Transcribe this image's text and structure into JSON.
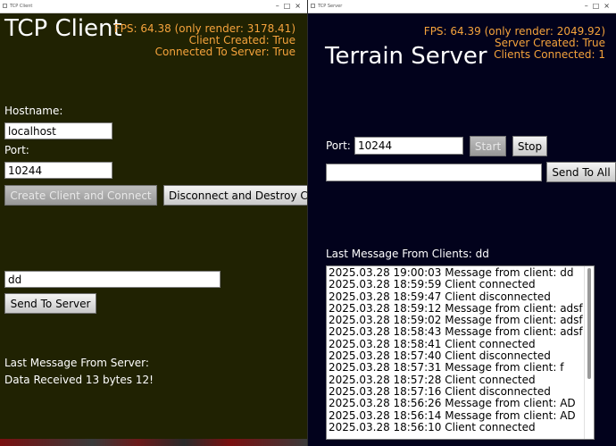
{
  "client": {
    "window_title": "TCP Client",
    "title": "TCP Client",
    "fps_text": "FPS: 64.38 (only render: 3178.41)",
    "status_created": "Client Created: True",
    "status_connected": "Connected To Server: True",
    "hostname_label": "Hostname:",
    "hostname_value": "localhost",
    "port_label": "Port:",
    "port_value": "10244",
    "create_button": "Create Client and Connect",
    "disconnect_button": "Disconnect and Destroy C",
    "message_value": "dd",
    "send_button": "Send To Server",
    "last_message_label": "Last Message From Server:",
    "last_message_value": "Data Received 13 bytes 12!"
  },
  "server": {
    "window_title": "TCP Server",
    "title": "Terrain Server",
    "fps_text": "FPS: 64.39 (only render: 2049.92)",
    "status_created": "Server Created: True",
    "status_clients": "Clients Connected: 1",
    "port_label": "Port:",
    "port_value": "10244",
    "start_button": "Start",
    "stop_button": "Stop",
    "message_value": "",
    "send_all_button": "Send To All",
    "last_message_label": "Last Message From Clients:  dd",
    "log": [
      "2025.03.28 19:00:03 Message from client: dd",
      "2025.03.28 18:59:59 Client connected",
      "2025.03.28 18:59:47 Client disconnected",
      "2025.03.28 18:59:12 Message from client: adsf",
      "2025.03.28 18:59:02 Message from client: adsf",
      "2025.03.28 18:58:43 Message from client: adsf",
      "2025.03.28 18:58:41 Client connected",
      "2025.03.28 18:57:40 Client disconnected",
      "2025.03.28 18:57:31 Message from client: f",
      "2025.03.28 18:57:28 Client connected",
      "2025.03.28 18:57:16 Client disconnected",
      "2025.03.28 18:56:26 Message from client: AD",
      "2025.03.28 18:56:14 Message from client: AD",
      "2025.03.28 18:56:10 Client connected"
    ]
  },
  "colors": {
    "client_bg": "#202202",
    "server_bg": "#02021c",
    "status_text": "#f5a33c"
  }
}
